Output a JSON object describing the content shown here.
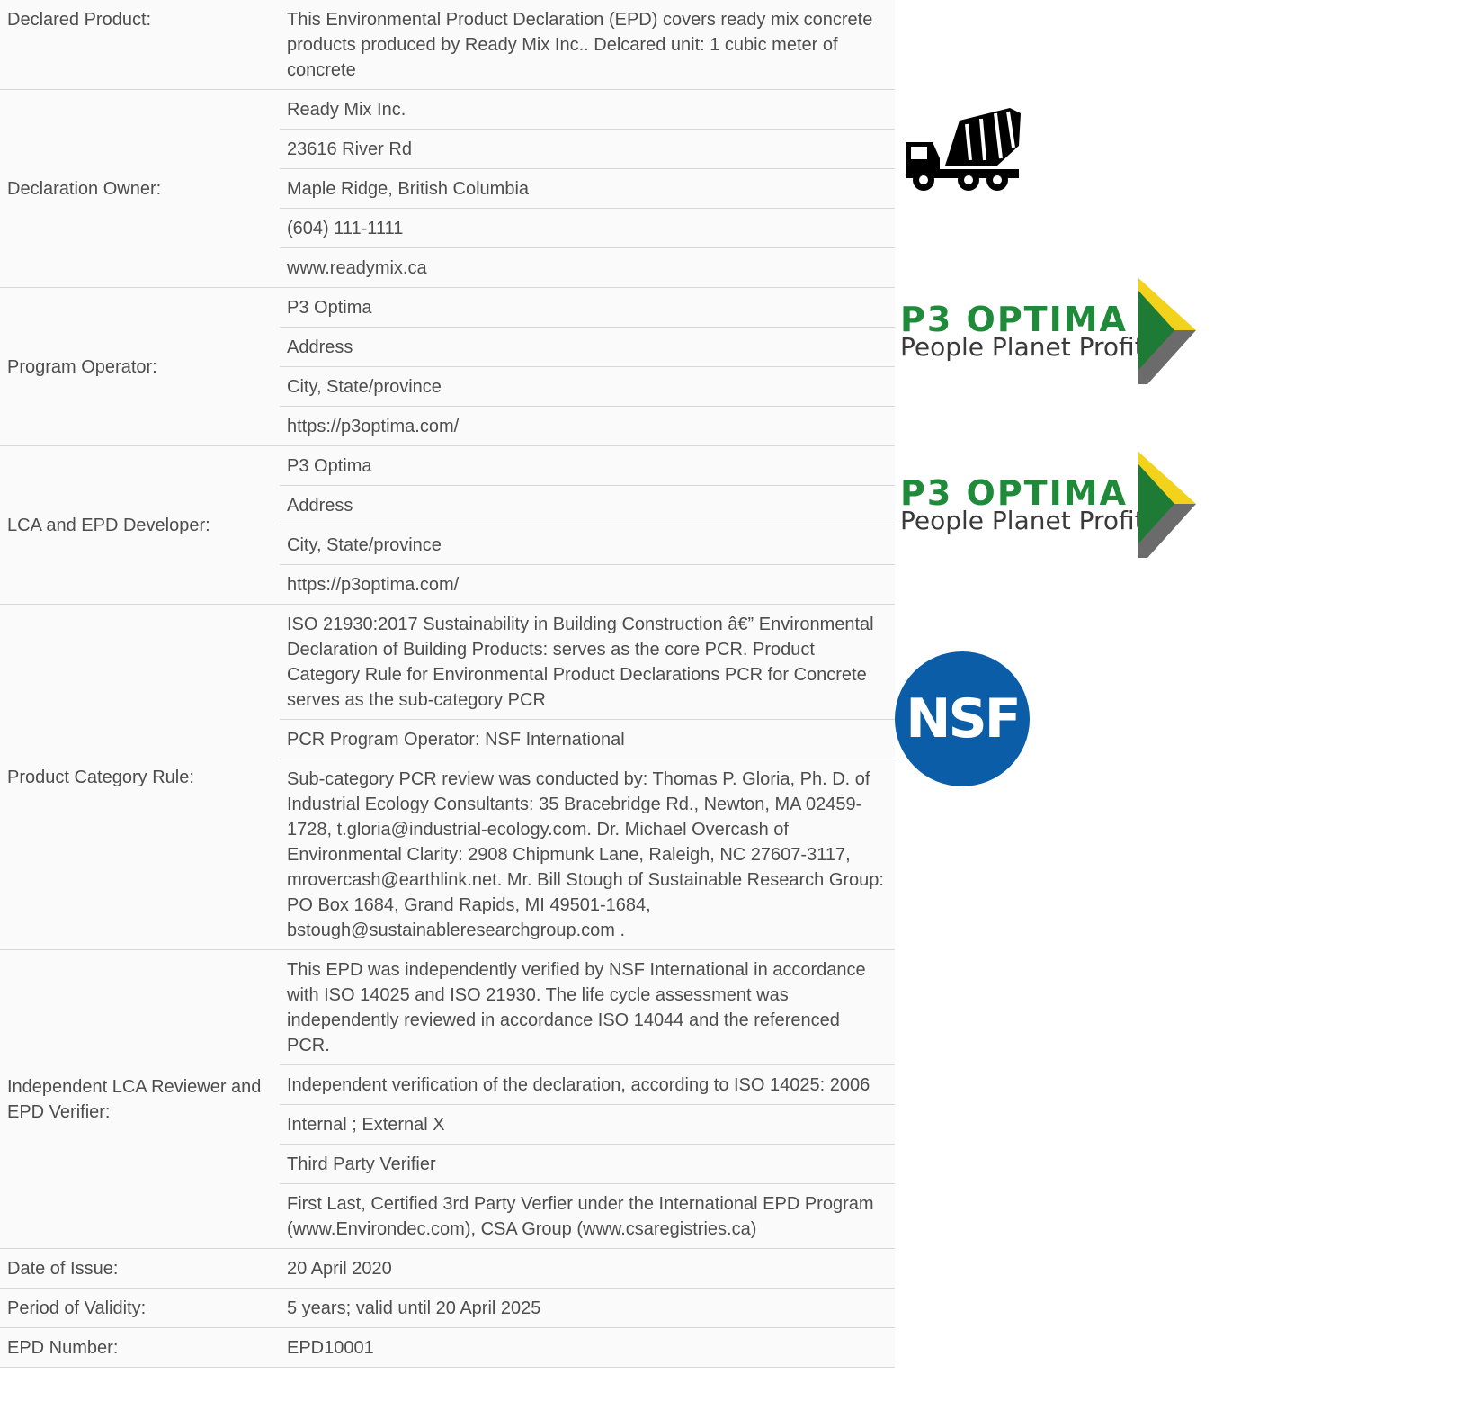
{
  "rows": [
    {
      "label": "Declared Product:",
      "values": [
        "This Environmental Product Declaration (EPD) covers ready mix concrete products produced by Ready Mix Inc.. Delcared unit: 1 cubic meter of concrete"
      ]
    },
    {
      "label": "Declaration Owner:",
      "values": [
        "Ready Mix Inc.",
        "23616 River Rd",
        "Maple Ridge, British Columbia",
        "(604) 111-1111",
        "www.readymix.ca"
      ]
    },
    {
      "label": "Program Operator:",
      "values": [
        "P3 Optima",
        "Address",
        "City, State/province",
        "https://p3optima.com/"
      ]
    },
    {
      "label": "LCA and EPD Developer:",
      "values": [
        "P3 Optima",
        "Address",
        "City, State/province",
        "https://p3optima.com/"
      ]
    },
    {
      "label": "Product Category Rule:",
      "values": [
        "ISO 21930:2017 Sustainability in Building Construction â€” Environmental Declaration of Building Products: serves as the core PCR. Product Category Rule for Environmental Product Declarations PCR for Concrete serves as the sub-category PCR",
        "PCR Program Operator: NSF International",
        "Sub-category PCR review was conducted by: Thomas P. Gloria, Ph. D. of Industrial Ecology Consultants: 35 Bracebridge Rd., Newton, MA 02459-1728, t.gloria@industrial-ecology.com. Dr. Michael Overcash of Environmental Clarity: 2908 Chipmunk Lane, Raleigh, NC 27607-3117, mrovercash@earthlink.net. Mr. Bill Stough of Sustainable Research Group: PO Box 1684, Grand Rapids, MI 49501-1684, bstough@sustainableresearchgroup.com ."
      ]
    },
    {
      "label": "Independent LCA Reviewer and EPD Verifier:",
      "values": [
        "This EPD was independently verified by NSF International in accordance with ISO 14025 and ISO 21930. The life cycle assessment was independently reviewed in accordance ISO 14044 and the referenced PCR.",
        "Independent verification of the declaration, according to ISO 14025: 2006",
        "Internal ; External X",
        "Third Party Verifier",
        "First Last, Certified 3rd Party Verfier under the International EPD Program (www.Environdec.com), CSA Group (www.csaregistries.ca)"
      ]
    },
    {
      "label": "Date of Issue:",
      "values": [
        "20 April 2020"
      ]
    },
    {
      "label": "Period of Validity:",
      "values": [
        "5 years; valid until 20 April 2025"
      ]
    },
    {
      "label": "EPD Number:",
      "values": [
        "EPD10001"
      ]
    }
  ],
  "logos": {
    "truck_icon": "concrete-mixer-truck-icon",
    "p3_brand": "P3 OPTIMA",
    "p3_tagline": "People Planet Profits",
    "nsf_brand": "NSF",
    "colors": {
      "p3_green": "#1e8a3a",
      "p3_yellow": "#f2d21b",
      "nsf_blue": "#0b5da8"
    }
  }
}
